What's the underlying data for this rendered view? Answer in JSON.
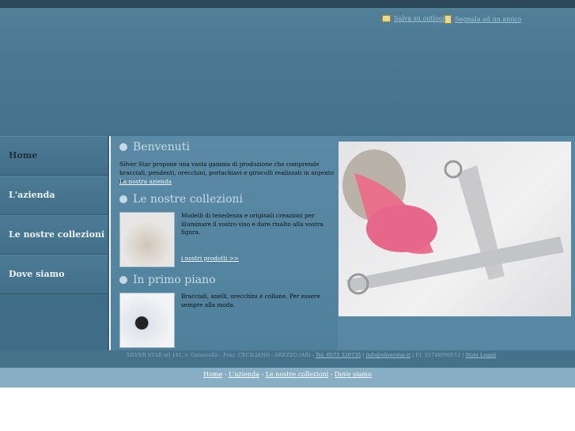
{
  "header": {
    "links": [
      {
        "label": "Salva su outlook",
        "icon": "outlook-icon"
      },
      {
        "label": "Segnala ad un amico",
        "icon": "friend-icon"
      }
    ]
  },
  "nav": {
    "items": [
      {
        "label": "Home",
        "active": true
      },
      {
        "label": "L'azienda"
      },
      {
        "label": "Le nostre collezioni"
      },
      {
        "label": "Dove siamo"
      }
    ]
  },
  "sections": {
    "welcome": {
      "title": "Benvenuti",
      "text": "Silver Star propone una vasta gamma di produzione che comprende bracciali, pendenti, orecchini, portachiavi e girocolli realizzati in argento e",
      "link": "La nostra azienda"
    },
    "collections": {
      "title": "Le nostre collezioni",
      "text": "Modelli di tenedenza e originali creazioni per illuminare il vostro viso e dare risalto alla vostra figura.",
      "link": "i nostri prodotti >>"
    },
    "featured": {
      "title": "In primo piano",
      "text": "Bracciali, anelli, orecchini e collane. Per essere sempre alla moda."
    }
  },
  "footer": {
    "address": "SILVER STAR srl 141, v. Carasvella - Fraz. CECILIANO - AREZZO (AR) - ",
    "phone": "Tel. 0575 320735",
    "sep1": " | ",
    "email": "info@silverstar.it",
    "vat": " | P.I. 01748090512 | ",
    "legal": "Note Legali"
  },
  "bottom_nav": {
    "items": [
      "Home",
      "L'azienda",
      "Le nostre collezioni",
      "Dove siamo"
    ],
    "sep": " - "
  }
}
